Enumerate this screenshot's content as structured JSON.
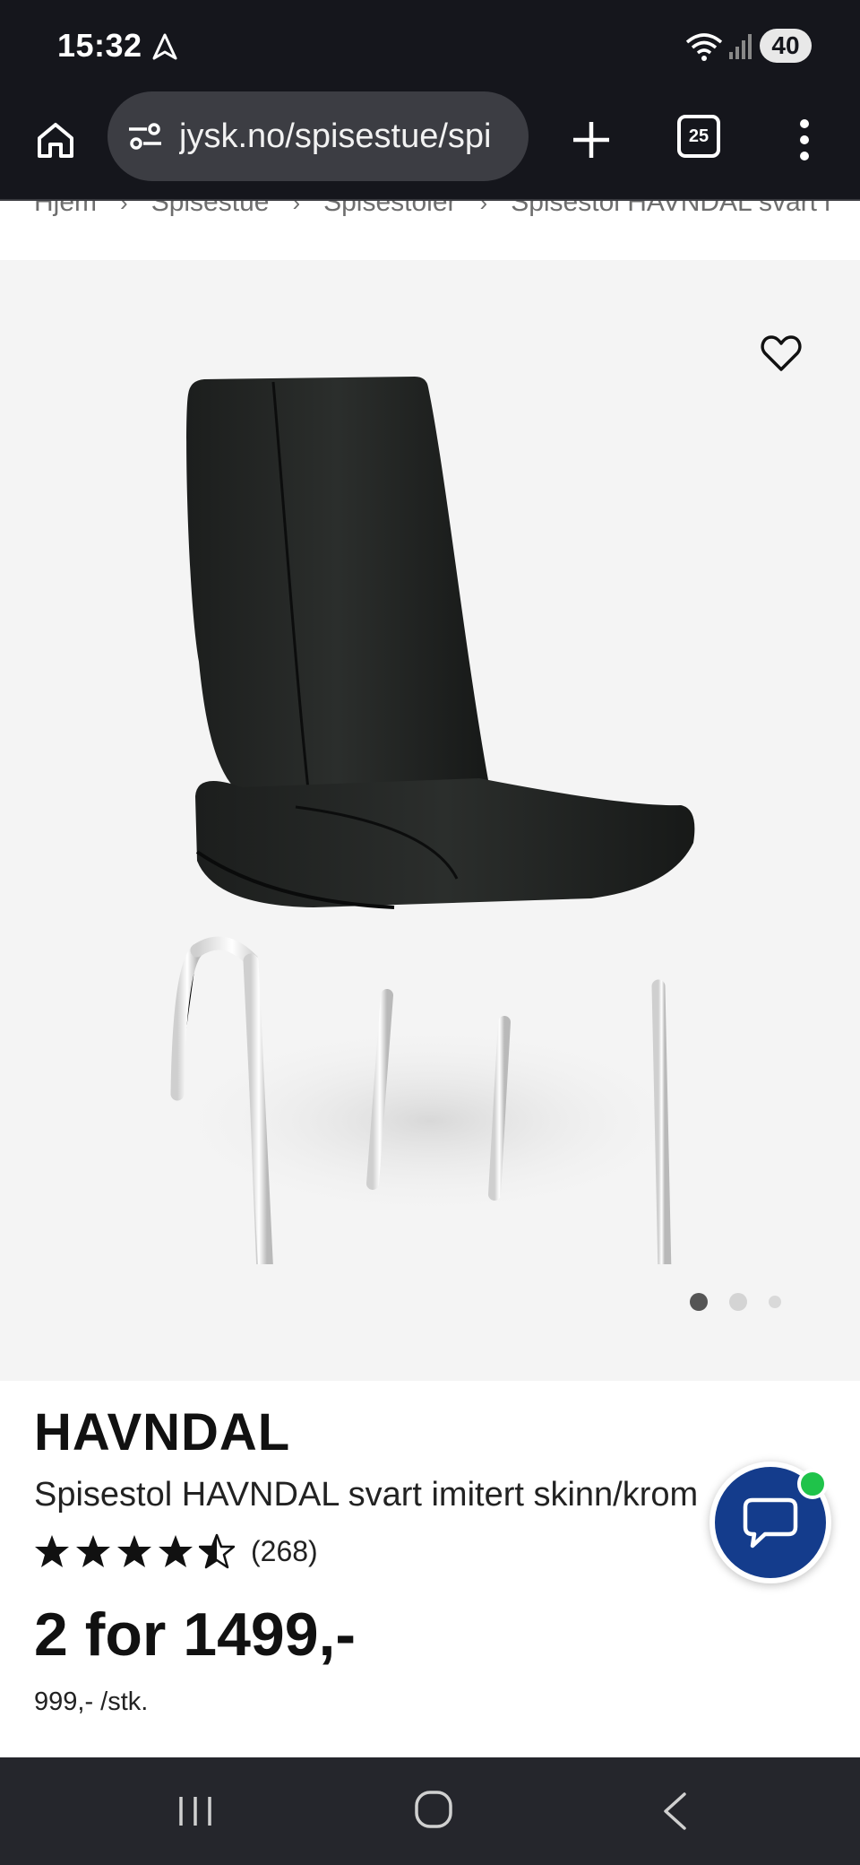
{
  "status_bar": {
    "time": "15:32",
    "battery": "40",
    "icons": [
      "navigation-arrow-icon",
      "wifi-icon",
      "signal-icon",
      "battery-icon"
    ]
  },
  "browser": {
    "url": "jysk.no/spisestue/spi",
    "tab_count": "25",
    "icons": [
      "home-icon",
      "site-settings-icon",
      "plus-icon",
      "tabs-icon",
      "menu-dots-icon"
    ]
  },
  "breadcrumb": {
    "items": [
      "Hjem",
      "Spisestue",
      "Spisestoler",
      "Spisestol HAVNDAL svart i"
    ],
    "separator": "›"
  },
  "product": {
    "brand": "HAVNDAL",
    "description": "Spisestol HAVNDAL svart imitert skinn/krom",
    "rating_value": 4.5,
    "review_count": "(268)",
    "price": "2 for 1499,-",
    "unit_price": "999,- /stk.",
    "image_index": 1,
    "image_count": 3
  },
  "colors": {
    "chat_blue": "#143c8c",
    "online_green": "#1fc34a",
    "status_bar_bg": "#15161c",
    "image_bg": "#f4f4f4"
  }
}
